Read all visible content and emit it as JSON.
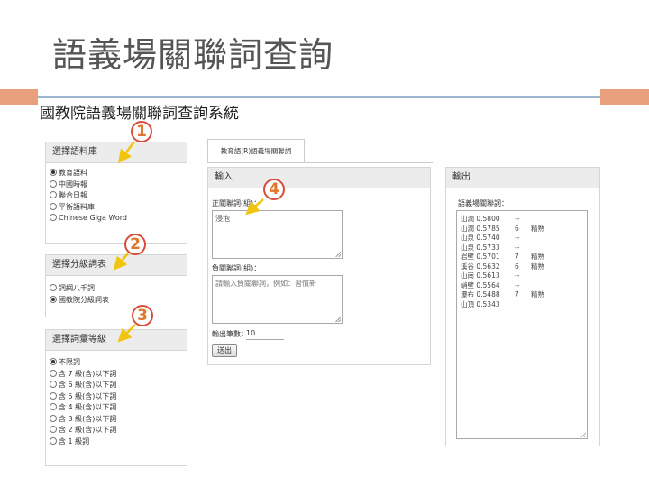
{
  "slide_title": "語義場關聯詞查詢",
  "system_title": "國教院語義場關聯詞查詢系統",
  "corpus_panel": {
    "heading": "選擇語料庫",
    "options": [
      "教育語料",
      "中國時報",
      "聯合日報",
      "平衡語料庫",
      "Chinese Giga Word"
    ],
    "selected_index": 0
  },
  "wordlist_panel": {
    "heading": "選擇分級詞表",
    "options": [
      "詞網八千詞",
      "國教院分級詞表"
    ],
    "selected_index": 1
  },
  "level_panel": {
    "heading": "選擇詞彙等級",
    "options": [
      "不限詞",
      "含 7 級(含)以下詞",
      "含 6 級(含)以下詞",
      "含 5 級(含)以下詞",
      "含 4 級(含)以下詞",
      "含 3 級(含)以下詞",
      "含 2 級(含)以下詞",
      "含 1 級詞"
    ],
    "selected_index": 0
  },
  "tab_label": "教育語(R)語義場關聯詞",
  "input_panel": {
    "heading": "輸入",
    "positive_label": "正關聯詞(組)：",
    "positive_value": "浸泡",
    "negative_label": "負關聯詞(組)：",
    "negative_placeholder": "請輸入負關聯詞，例如：習慣新",
    "count_label": "輸出筆數：",
    "count_value": "10",
    "submit_label": "送出"
  },
  "output_panel": {
    "heading": "輸出",
    "result_label": "語義場關聯詞：",
    "results": [
      {
        "word": "山澗 0.5800",
        "dash": "--",
        "level": ""
      },
      {
        "word": "山澗 0.5785",
        "dash": "6",
        "level": "精熟"
      },
      {
        "word": "山泉 0.5740",
        "dash": "--",
        "level": ""
      },
      {
        "word": "山泉 0.5733",
        "dash": "--",
        "level": ""
      },
      {
        "word": "岩壁 0.5701",
        "dash": "7",
        "level": "精熟"
      },
      {
        "word": "溪谷 0.5632",
        "dash": "6",
        "level": "精熟"
      },
      {
        "word": "山崗 0.5613",
        "dash": "--",
        "level": ""
      },
      {
        "word": "峭壁 0.5564",
        "dash": "--",
        "level": ""
      },
      {
        "word": "瀑布 0.5488",
        "dash": "7",
        "level": "精熟"
      },
      {
        "word": "山頂 0.5343",
        "dash": "",
        "level": ""
      }
    ]
  },
  "markers": [
    "1",
    "2",
    "3",
    "4"
  ],
  "colors": {
    "accent": "#e8a07c",
    "rule": "#9eb6cd",
    "marker_ring": "#d84b3a",
    "marker_text": "#e0762c"
  }
}
